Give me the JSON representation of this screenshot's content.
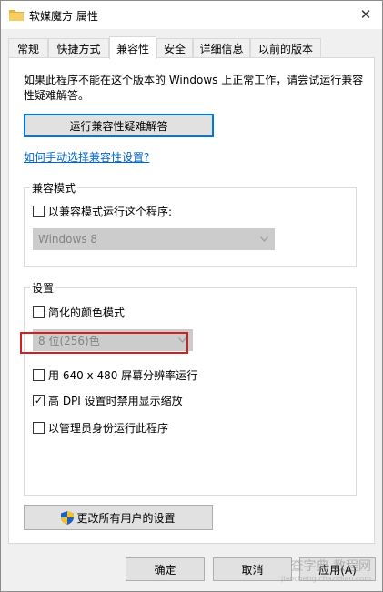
{
  "window": {
    "title": "软媒魔方 属性",
    "close_glyph": "✕"
  },
  "tabs": [
    {
      "label": "常规",
      "active": false
    },
    {
      "label": "快捷方式",
      "active": false
    },
    {
      "label": "兼容性",
      "active": true
    },
    {
      "label": "安全",
      "active": false
    },
    {
      "label": "详细信息",
      "active": false
    },
    {
      "label": "以前的版本",
      "active": false
    }
  ],
  "compat": {
    "intro": "如果此程序不能在这个版本的 Windows 上正常工作，请尝试运行兼容性疑难解答。",
    "troubleshoot_label": "运行兼容性疑难解答",
    "manual_link": "如何手动选择兼容性设置?"
  },
  "compat_mode": {
    "group_label": "兼容模式",
    "checkbox_label": "以兼容模式运行这个程序:",
    "checked": false,
    "os_select": "Windows 8"
  },
  "settings": {
    "group_label": "设置",
    "reduced_color_label": "简化的颜色模式",
    "reduced_color_checked": false,
    "color_select": "8 位(256)色",
    "res_640_label": "用 640 x 480 屏幕分辨率运行",
    "res_640_checked": false,
    "dpi_label": "高 DPI 设置时禁用显示缩放",
    "dpi_checked": true,
    "admin_label": "以管理员身份运行此程序",
    "admin_checked": false
  },
  "all_users_label": "更改所有用户的设置",
  "footer": {
    "ok_label": "确定",
    "cancel_label": "取消",
    "apply_label": "应用(A)"
  },
  "watermark": {
    "line1": "查字典 教程网",
    "line2": "jiaocheng.chazidian.com"
  },
  "icons": {
    "title_icon": "folder-icon",
    "shield_icon": "uac-shield-icon",
    "check_glyph": "✓"
  },
  "colors": {
    "link": "#0066cc",
    "highlight": "#d02020",
    "focus": "#0078d7"
  }
}
